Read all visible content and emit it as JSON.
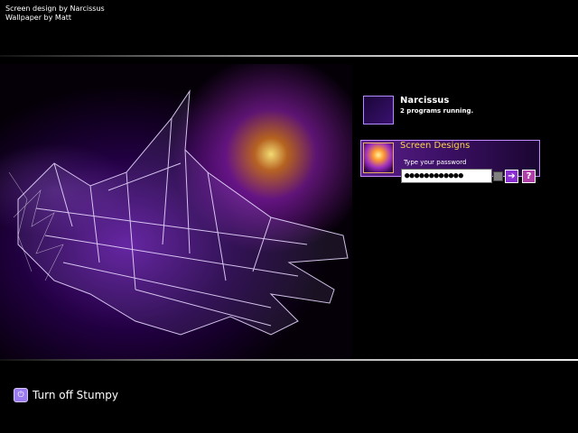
{
  "credits": {
    "line1": "Screen design by Narcissus",
    "line2": "Wallpaper by Matt"
  },
  "users": [
    {
      "name": "Narcissus",
      "status": "2 programs running."
    },
    {
      "name": "Screen Designs",
      "password_label": "Type your password",
      "password_value": "●●●●●●●●●●●●"
    }
  ],
  "buttons": {
    "go": "➔",
    "help": "?"
  },
  "footer": {
    "turn_off_label": "Turn off Stumpy"
  },
  "icons": {
    "go": "arrow-right-icon",
    "help": "question-icon",
    "power": "power-icon",
    "keyboard": "keyboard-layout-icon"
  },
  "colors": {
    "accent_gold": "#ffd24a",
    "accent_purple": "#8a2fd0"
  }
}
